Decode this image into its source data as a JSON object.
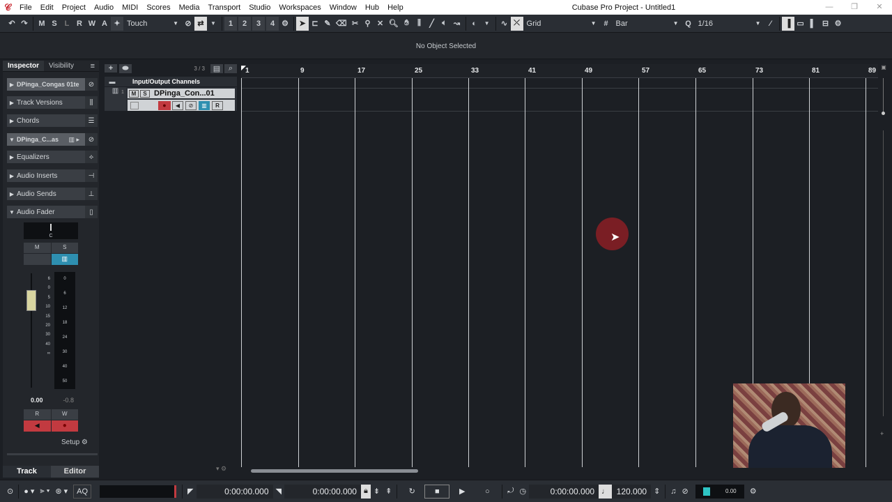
{
  "menu": {
    "items": [
      "File",
      "Edit",
      "Project",
      "Audio",
      "MIDI",
      "Scores",
      "Media",
      "Transport",
      "Studio",
      "Workspaces",
      "Window",
      "Hub",
      "Help"
    ],
    "title": "Cubase Pro Project - Untitled1"
  },
  "toolbar": {
    "btn_m": "M",
    "btn_s": "S",
    "btn_l": "L",
    "btn_r": "R",
    "btn_w": "W",
    "btn_a": "A",
    "automation_mode": "Touch",
    "nums": [
      "1",
      "2",
      "3",
      "4"
    ],
    "snap_type": "Grid",
    "grid_type": "Bar",
    "quantize": "1/16"
  },
  "info": {
    "status": "No Object Selected"
  },
  "inspector": {
    "tabs": [
      "Inspector",
      "Visibility"
    ],
    "track_name": "DPinga_Congas 01te",
    "sections": [
      "Track Versions",
      "Chords",
      "DPinga_C...as",
      "Equalizers",
      "Audio Inserts",
      "Audio Sends",
      "Audio Fader"
    ],
    "pan": "C",
    "ms": {
      "m": "M",
      "s": "S"
    },
    "fader_scale": [
      "6",
      "0",
      "5",
      "10",
      "15",
      "20",
      "30",
      "40",
      "∞"
    ],
    "meter_scale": [
      "0",
      "6",
      "12",
      "18",
      "24",
      "30",
      "40",
      "50"
    ],
    "fader_value": "0.00",
    "peak_value": "-0.8",
    "rw": {
      "r": "R",
      "w": "W"
    },
    "setup": "Setup",
    "bottom_tabs": [
      "Track",
      "Editor"
    ]
  },
  "tracklist": {
    "counter": "3 / 3",
    "folder": "Input/Output Channels",
    "track_num": "1",
    "track_name": "DPinga_Con...01",
    "m": "M",
    "s": "S",
    "r": "R"
  },
  "ruler": {
    "bars": [
      "1",
      "9",
      "17",
      "25",
      "33",
      "41",
      "49",
      "57",
      "65",
      "73",
      "81",
      "89"
    ]
  },
  "transport": {
    "time1": "0:00:00.000",
    "time2": "0:00:00.000",
    "time3": "0:00:00.000",
    "tempo": "120.000",
    "aq": "AQ",
    "level": "0.00"
  }
}
